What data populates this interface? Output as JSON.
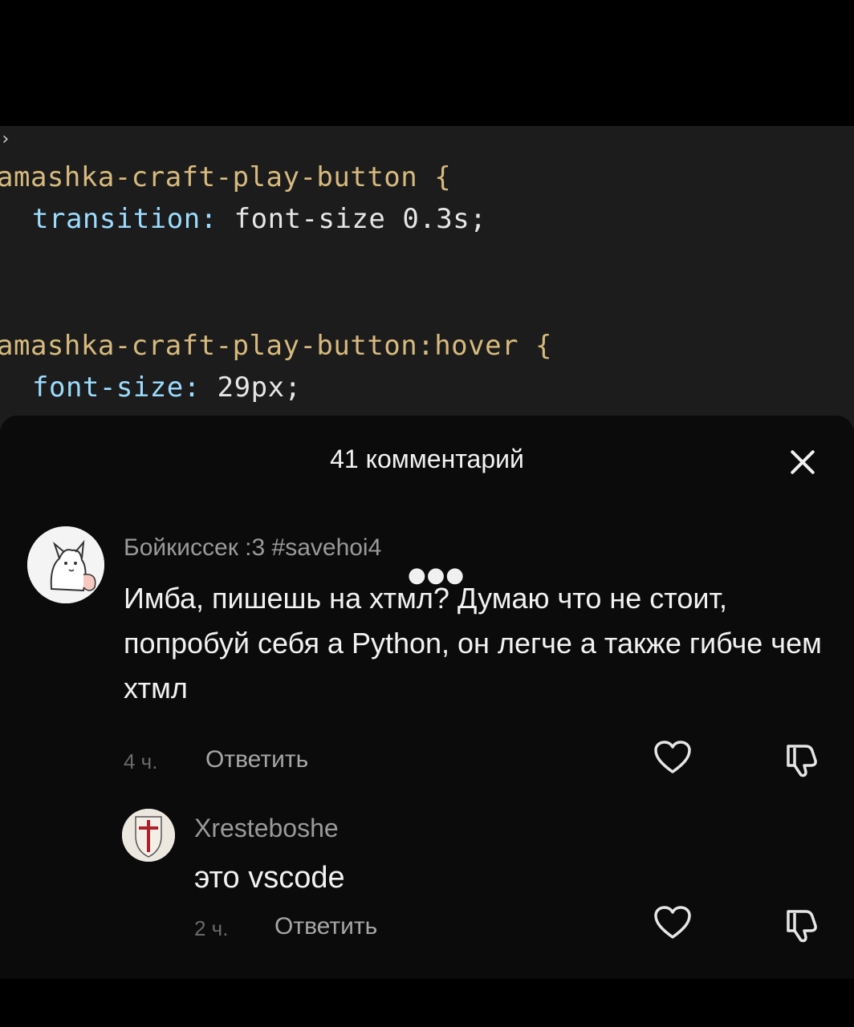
{
  "editor": {
    "lines": [
      {
        "selector": "amashka-craft-play-button {",
        "prop": "",
        "value": ""
      },
      {
        "selector": "",
        "prop": "transition:",
        "value": " font-size 0.3s;"
      },
      {
        "selector": "amashka-craft-play-button:hover {",
        "prop": "",
        "value": ""
      },
      {
        "selector": "",
        "prop": "font-size:",
        "value": " 29px;"
      }
    ]
  },
  "comments_sheet": {
    "title": "41 комментарий",
    "comments": [
      {
        "author": "Бойкиссек :3 #savehoi4",
        "text": "Имба, пишешь на хтмл? Думаю что не стоит, попробуй себя а Python, он легче а также гибче чем хтмл",
        "time": "4 ч.",
        "reply_label": "Ответить"
      },
      {
        "author": "Xresteboshe",
        "text": "это vscode",
        "time": "2 ч.",
        "reply_label": "Ответить"
      }
    ]
  },
  "icons": {
    "close": "close-icon",
    "like": "heart-icon",
    "dislike": "thumbs-down-icon",
    "more": "more-dots-icon"
  },
  "colors": {
    "editor_bg": "#1c1c1c",
    "sheet_bg": "#0b0b0b",
    "selector": "#d7ba7d",
    "property": "#9cdcfe",
    "text": "#f2f2f2",
    "muted": "#9a9a9a"
  }
}
